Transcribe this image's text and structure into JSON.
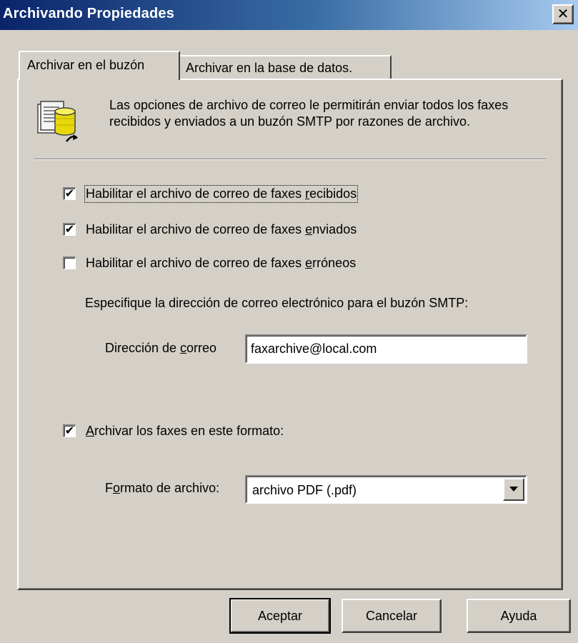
{
  "window": {
    "title": "Archivando Propiedades",
    "close_glyph": "✕"
  },
  "tabs": [
    {
      "label": "Archivar en el buzón",
      "active": true
    },
    {
      "label": "Archivar en la base de datos.",
      "active": false
    }
  ],
  "description": "Las opciones de archivo de correo le permitirán enviar todos los faxes recibidos y enviados a un buzón SMTP por razones de archivo.",
  "checkboxes": [
    {
      "prefix": "Habilitar el archivo de correo de faxes ",
      "mnemonic": "r",
      "suffix": "ecibidos",
      "checked": true
    },
    {
      "prefix": "Habilitar el archivo de correo de faxes ",
      "mnemonic": "e",
      "suffix": "nviados",
      "checked": true
    },
    {
      "prefix": "Habilitar el archivo de correo de faxes ",
      "mnemonic": "e",
      "suffix": "rróneos",
      "checked": false
    }
  ],
  "smtp_label": "Especifique la dirección de correo electrónico para el buzón SMTP:",
  "email": {
    "label_prefix": "Dirección de ",
    "label_mnemonic": "c",
    "label_suffix": "orreo",
    "value": "faxarchive@local.com"
  },
  "format_checkbox": {
    "prefix": "",
    "mnemonic": "A",
    "suffix": "rchivar los faxes en este formato:",
    "checked": true
  },
  "format": {
    "label_prefix": "F",
    "label_mnemonic": "o",
    "label_suffix": "rmato de archivo:",
    "selected": "archivo PDF (.pdf)"
  },
  "buttons": {
    "ok": "Aceptar",
    "cancel": "Cancelar",
    "help": "Ayuda"
  },
  "check_glyph": "✔",
  "icons": {
    "info": "archive-database-icon",
    "dropdown": "chevron-down-icon",
    "close": "close-icon"
  }
}
